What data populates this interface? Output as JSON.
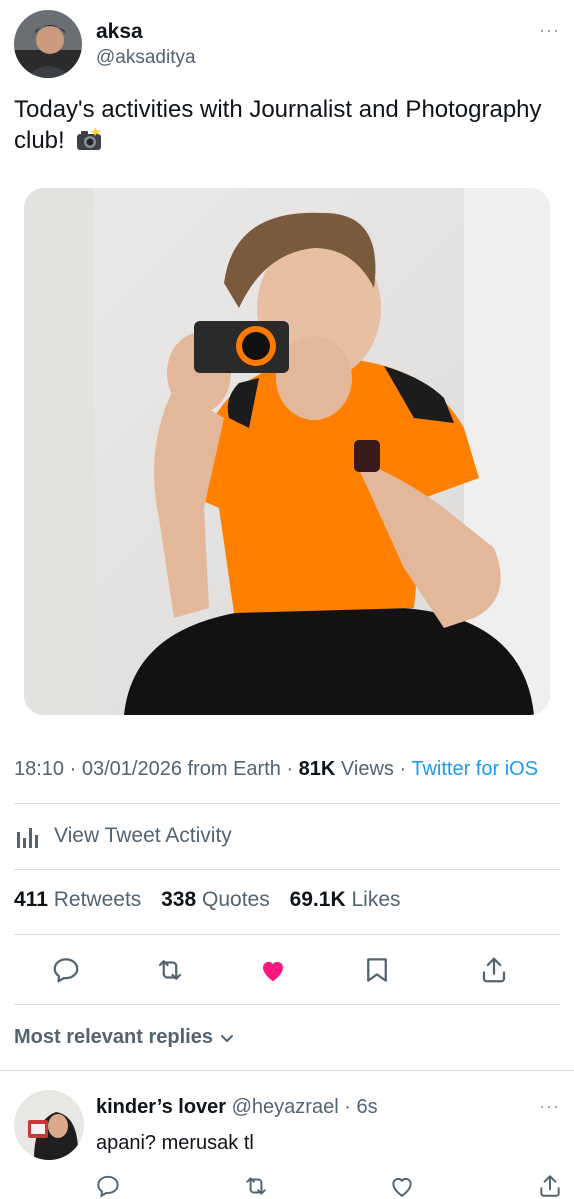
{
  "tweet": {
    "author": {
      "display_name": "aksa",
      "handle": "@aksaditya"
    },
    "text": "Today's activities with Journalist and Photography club!",
    "emoji": "camera-with-flash",
    "meta": {
      "time": "18:10",
      "date": "03/01/2026",
      "location": "from Earth",
      "views_count": "81K",
      "views_label": "Views",
      "source": "Twitter for iOS"
    },
    "activity_label": "View Tweet Activity",
    "stats": {
      "retweets_count": "411",
      "retweets_label": "Retweets",
      "quotes_count": "338",
      "quotes_label": "Quotes",
      "likes_count": "69.1K",
      "likes_label": "Likes"
    },
    "more": "···",
    "liked": true
  },
  "actions": [
    "reply-icon",
    "retweet-icon",
    "like-icon",
    "bookmark-icon",
    "share-icon"
  ],
  "replies": {
    "filter_label": "Most relevant replies",
    "items": [
      {
        "display_name": "kinder’s lover",
        "handle": "@heyazrael",
        "time": "6s",
        "text": "apani? merusak tl",
        "more": "···"
      }
    ]
  },
  "colors": {
    "text": "#0f1419",
    "secondary": "#536471",
    "link": "#1d9bf0",
    "like": "#f91880",
    "divider": "#d9dde1",
    "shirt": "#ff8000"
  }
}
